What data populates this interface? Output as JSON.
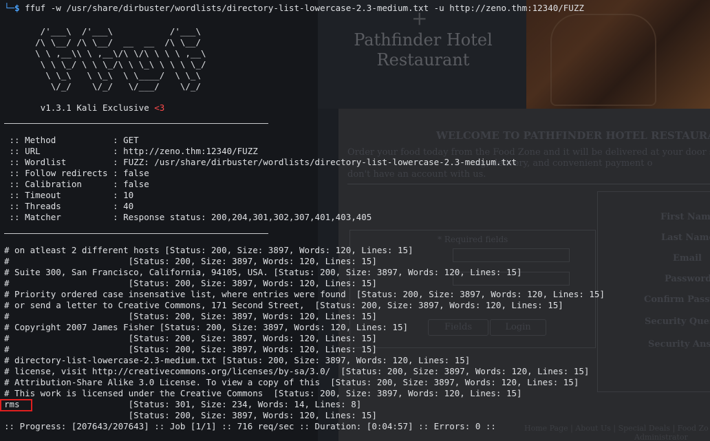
{
  "background_site": {
    "logo_line1": "Pathfinder Hotel",
    "logo_line2": "Restaurant",
    "welcome": "WELCOME TO PATHFINDER HOTEL RESTAURA",
    "para1": "Order your food today from the Food Zone and it will be delivered at your door step. Fe",
    "para2": "ng, delivery, and convenient payment o",
    "para3": "don't have an account with us.",
    "required_fields": "* Required fields",
    "login_button": "Login",
    "fields_button": "Fields",
    "reg_labels": [
      "First Name",
      "Last Name",
      "Email",
      "Password",
      "Confirm Passw",
      "Security Quest",
      "Security Answ"
    ],
    "footer_links": "Home Page | About Us | Special Deals | Food Zo",
    "footer_sub": "Administrator"
  },
  "terminal": {
    "command": "ffuf -w /usr/share/dirbuster/wordlists/directory-list-lowercase-2.3-medium.txt -u http://zeno.thm:12340/FUZZ",
    "banner": [
      "       /'___\\  /'___\\           /'___\\",
      "      /\\ \\__/ /\\ \\__/  __  __  /\\ \\__/",
      "      \\ \\ ,__\\\\ \\ ,__\\/\\ \\/\\ \\ \\ \\ ,__\\",
      "       \\ \\ \\_/ \\ \\ \\_/\\ \\ \\_\\ \\ \\ \\ \\_/",
      "        \\ \\_\\   \\ \\_\\  \\ \\____/  \\ \\_\\",
      "         \\/_/    \\/_/   \\/___/    \\/_/"
    ],
    "version_prefix": "       v1.3.1 Kali Exclusive ",
    "version_heart": "<3",
    "config": [
      " :: Method           : GET",
      " :: URL              : http://zeno.thm:12340/FUZZ",
      " :: Wordlist         : FUZZ: /usr/share/dirbuster/wordlists/directory-list-lowercase-2.3-medium.txt",
      " :: Follow redirects : false",
      " :: Calibration      : false",
      " :: Timeout          : 10",
      " :: Threads          : 40",
      " :: Matcher          : Response status: 200,204,301,302,307,401,403,405"
    ],
    "results": [
      "# on atleast 2 different hosts [Status: 200, Size: 3897, Words: 120, Lines: 15]",
      "#                       [Status: 200, Size: 3897, Words: 120, Lines: 15]",
      "# Suite 300, San Francisco, California, 94105, USA. [Status: 200, Size: 3897, Words: 120, Lines: 15]",
      "#                       [Status: 200, Size: 3897, Words: 120, Lines: 15]",
      "# Priority ordered case insensative list, where entries were found  [Status: 200, Size: 3897, Words: 120, Lines: 15]",
      "# or send a letter to Creative Commons, 171 Second Street,  [Status: 200, Size: 3897, Words: 120, Lines: 15]",
      "#                       [Status: 200, Size: 3897, Words: 120, Lines: 15]",
      "# Copyright 2007 James Fisher [Status: 200, Size: 3897, Words: 120, Lines: 15]",
      "#                       [Status: 200, Size: 3897, Words: 120, Lines: 15]",
      "#                       [Status: 200, Size: 3897, Words: 120, Lines: 15]",
      "# directory-list-lowercase-2.3-medium.txt [Status: 200, Size: 3897, Words: 120, Lines: 15]",
      "# license, visit http://creativecommons.org/licenses/by-sa/3.0/  [Status: 200, Size: 3897, Words: 120, Lines: 15]",
      "# Attribution-Share Alike 3.0 License. To view a copy of this  [Status: 200, Size: 3897, Words: 120, Lines: 15]",
      "# This work is licensed under the Creative Commons  [Status: 200, Size: 3897, Words: 120, Lines: 15]",
      "rms                     [Status: 301, Size: 234, Words: 14, Lines: 8]",
      "                        [Status: 200, Size: 3897, Words: 120, Lines: 15]"
    ],
    "progress": ":: Progress: [207643/207643] :: Job [1/1] :: 716 req/sec :: Duration: [0:04:57] :: Errors: 0 ::",
    "highlighted_result": "rms"
  },
  "colors": {
    "prompt": "#4aa3ff",
    "heart": "#ff4b4b",
    "highlight_box": "#e01f1f",
    "terminal_text": "#dfe1e4"
  }
}
